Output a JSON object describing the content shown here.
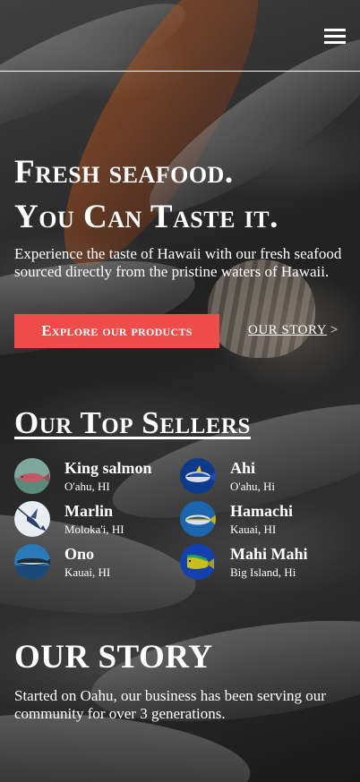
{
  "hero": {
    "title_line1": "Fresh seafood.",
    "title_line2": "You Can Taste it.",
    "description": "Experience the taste of Hawaii with our fresh seafood sourced directly from the pristine waters of Hawaii.",
    "cta_label": "Explore our products",
    "story_link_label": "OUR STORY",
    "story_link_arrow": ">"
  },
  "top_sellers": {
    "title": "Our Top Sellers",
    "items": [
      {
        "name": "King salmon",
        "location": "O'ahu, HI",
        "icon": "salmon-icon",
        "color": "#c05868"
      },
      {
        "name": "Ahi",
        "location": "O'ahu, Hi",
        "icon": "tuna-icon",
        "color": "#1f4fb0"
      },
      {
        "name": "Marlin",
        "location": "Moloka'i, HI",
        "icon": "marlin-icon",
        "color": "#2a3f6a"
      },
      {
        "name": "Hamachi",
        "location": "Kauai, HI",
        "icon": "hamachi-icon",
        "color": "#1c66b0"
      },
      {
        "name": "Ono",
        "location": "Kauai, HI",
        "icon": "ono-icon",
        "color": "#1a5a8a"
      },
      {
        "name": "Mahi Mahi",
        "location": "Big Island, Hi",
        "icon": "mahi-mahi-icon",
        "color": "#c8c018"
      }
    ]
  },
  "story": {
    "title": "OUR STORY",
    "text": "Started on Oahu, our business has been serving our community for over 3 generations."
  },
  "colors": {
    "accent": "#f04b4b",
    "text": "#ffffff"
  }
}
